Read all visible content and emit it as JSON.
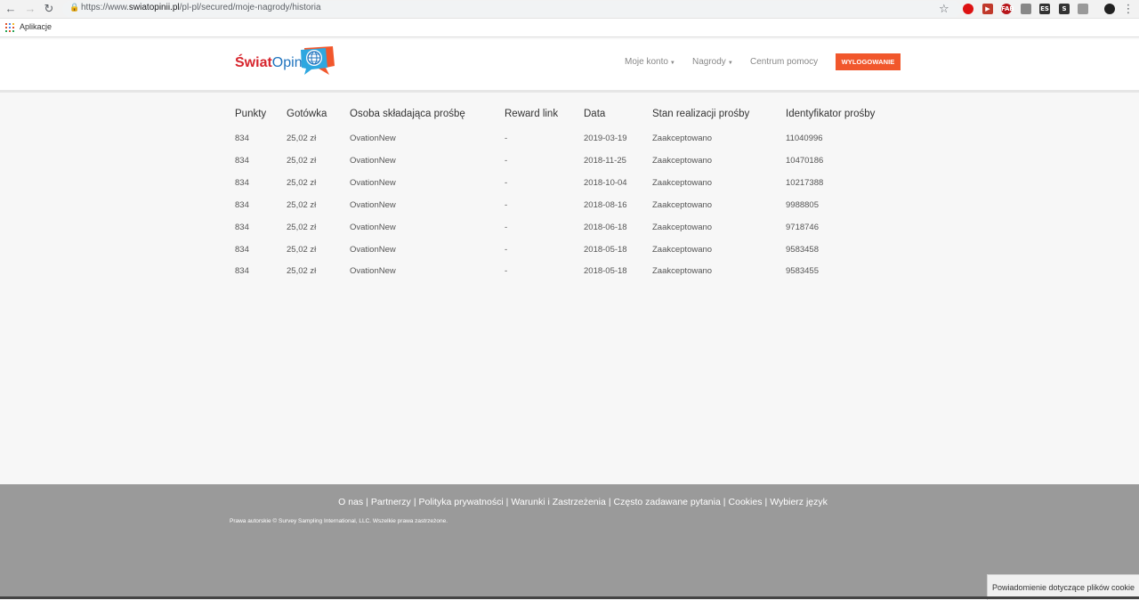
{
  "browser": {
    "url_prefix": "https://www.",
    "url_domain": "swiatopinii.pl",
    "url_path": "/pl-pl/secured/moje-nagrody/historia",
    "bookmark_apps": "Aplikacje",
    "ext_labels": [
      "",
      "",
      "FAB",
      "",
      "ES",
      "S",
      "",
      ""
    ]
  },
  "header": {
    "logo_part1": "Świat",
    "logo_part2": "Opinii",
    "nav": {
      "account": "Moje konto",
      "rewards": "Nagrody",
      "help": "Centrum pomocy",
      "logout": "WYLOGOWANIE"
    }
  },
  "table": {
    "headers": [
      "Punkty",
      "Gotówka",
      "Osoba składająca prośbę",
      "Reward link",
      "Data",
      "Stan realizacji prośby",
      "Identyfikator prośby"
    ],
    "rows": [
      [
        "834",
        "25,02 zł",
        "OvationNew",
        "-",
        "2019-03-19",
        "Zaakceptowano",
        "11040996"
      ],
      [
        "834",
        "25,02 zł",
        "OvationNew",
        "-",
        "2018-11-25",
        "Zaakceptowano",
        "10470186"
      ],
      [
        "834",
        "25,02 zł",
        "OvationNew",
        "-",
        "2018-10-04",
        "Zaakceptowano",
        "10217388"
      ],
      [
        "834",
        "25,02 zł",
        "OvationNew",
        "-",
        "2018-08-16",
        "Zaakceptowano",
        "9988805"
      ],
      [
        "834",
        "25,02 zł",
        "OvationNew",
        "-",
        "2018-06-18",
        "Zaakceptowano",
        "9718746"
      ],
      [
        "834",
        "25,02 zł",
        "OvationNew",
        "-",
        "2018-05-18",
        "Zaakceptowano",
        "9583458"
      ],
      [
        "834",
        "25,02 zł",
        "OvationNew",
        "-",
        "2018-05-18",
        "Zaakceptowano",
        "9583455"
      ]
    ]
  },
  "footer": {
    "links": [
      "O nas",
      "Partnerzy",
      "Polityka prywatności",
      "Warunki i Zastrzeżenia",
      "Często zadawane pytania",
      "Cookies",
      "Wybierz język"
    ],
    "copyright": "Prawa autorskie © Survey Sampling International, LLC. Wszelkie prawa zastrzeżone.",
    "cookie_notice": "Powiadomienie dotyczące plików cookie"
  },
  "colors": {
    "accent": "#f1572c",
    "footer_bg": "#9a9a9a",
    "logo_red": "#d7262e",
    "logo_blue": "#1e73be"
  }
}
